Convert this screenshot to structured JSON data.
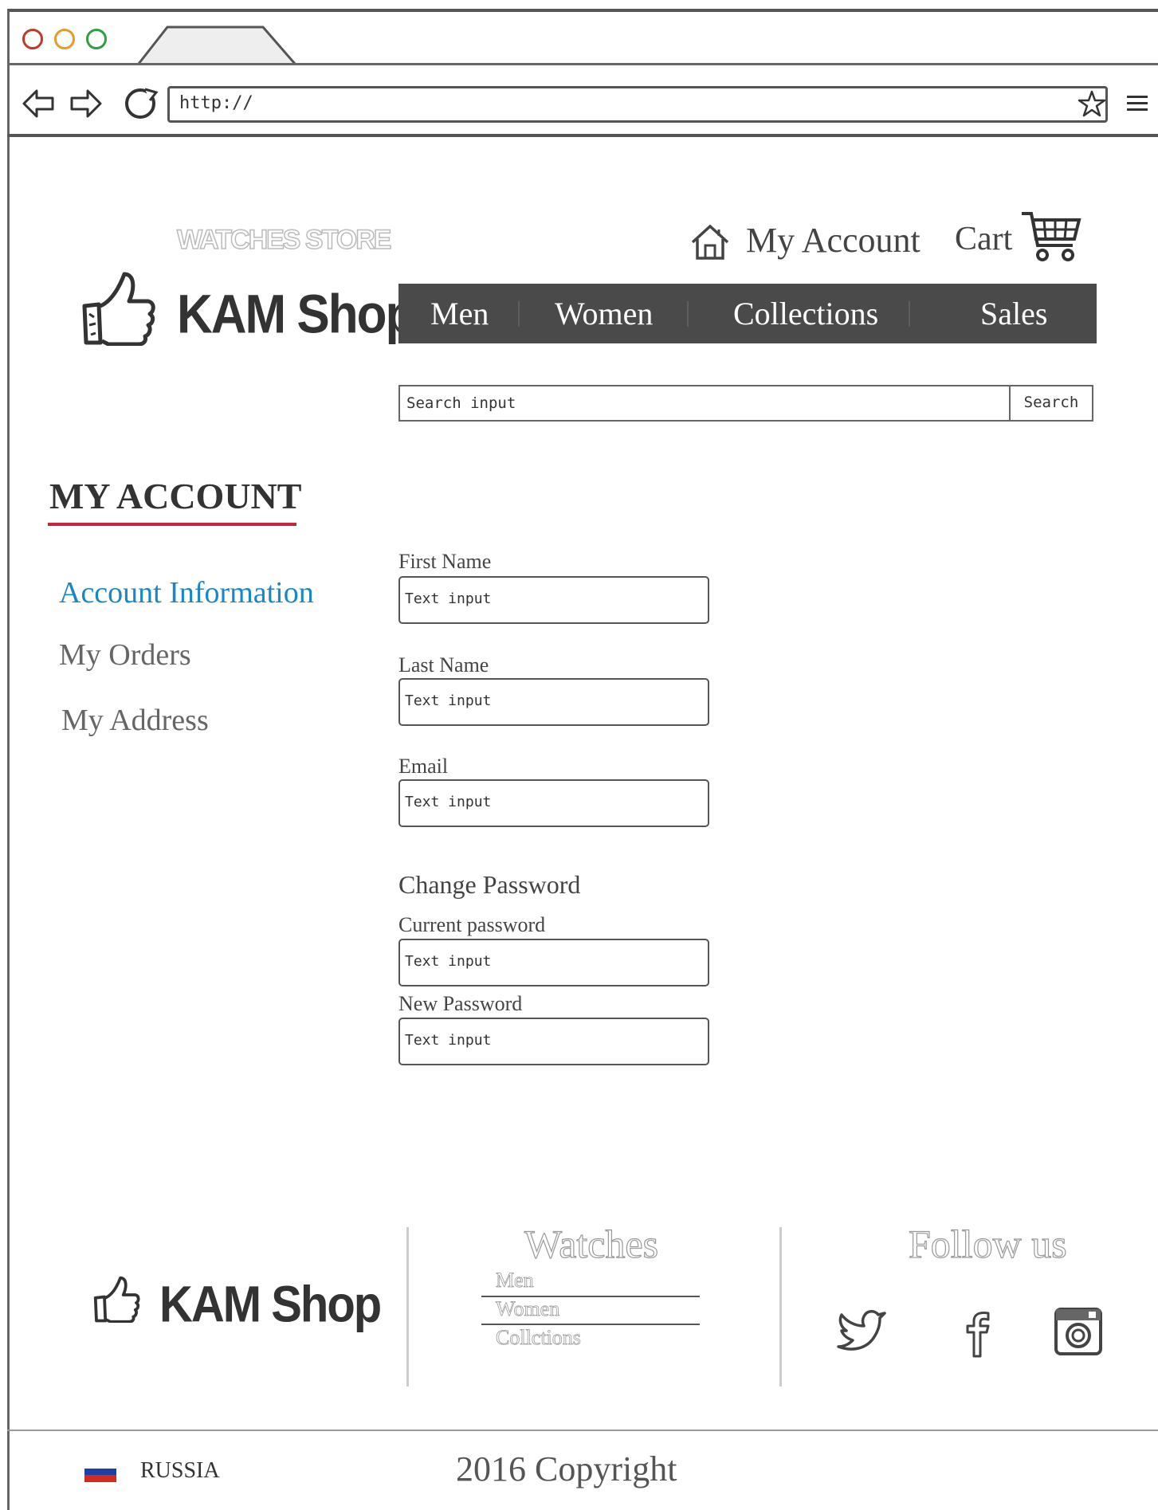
{
  "browser": {
    "url": "http://",
    "accent_colors": {
      "close": "#c0392b",
      "minimize": "#e69b2b",
      "maximize": "#2f9e44"
    }
  },
  "header": {
    "brand_sub": "WATCHES STORE",
    "brand_name": "KAM Shop",
    "my_account": "My Account",
    "cart": "Cart"
  },
  "nav": {
    "items": [
      "Men",
      "Women",
      "Collections",
      "Sales"
    ]
  },
  "search": {
    "placeholder": "Search input",
    "button": "Search"
  },
  "sidebar": {
    "title": "MY ACCOUNT",
    "underline_color": "#c9243d",
    "active_color": "#1a86c8",
    "items": [
      "Account Information",
      "My Orders",
      "My Address"
    ]
  },
  "form": {
    "first_name_label": "First Name",
    "last_name_label": "Last Name",
    "email_label": "Email",
    "change_password_heading": "Change Password",
    "current_password_label": "Current password",
    "new_password_label": "New Password",
    "input_placeholder": "Text input"
  },
  "footer": {
    "brand": "KAM Shop",
    "watches_heading": "Watches",
    "watches_links": [
      "Men",
      "Women",
      "Collctions"
    ],
    "follow_heading": "Follow us",
    "social_icons": [
      "twitter-icon",
      "facebook-icon",
      "instagram-icon"
    ],
    "country": "RUSSIA",
    "copyright": "2016 Copyright"
  }
}
